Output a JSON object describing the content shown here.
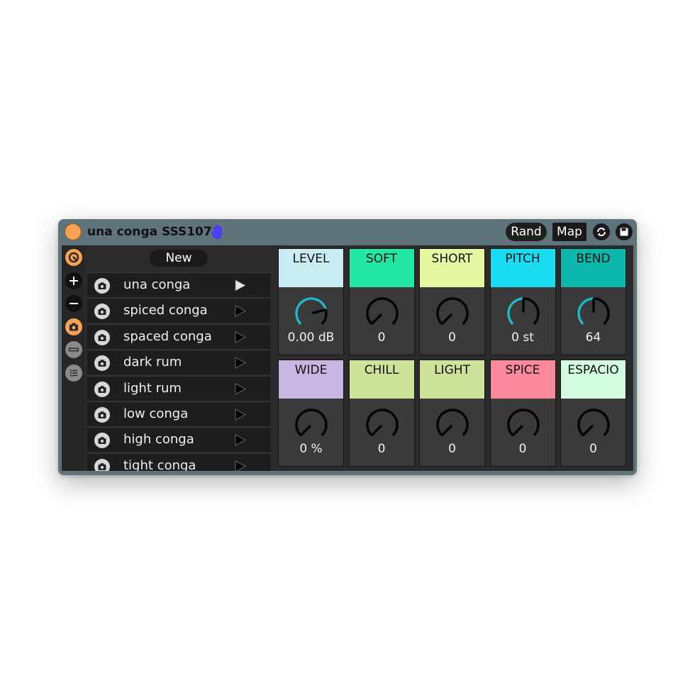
{
  "device": {
    "title": "una conga SSS107",
    "rand_label": "Rand",
    "map_label": "Map",
    "icons": [
      "power-icon",
      "hand-icon",
      "sync-icon",
      "save-icon"
    ]
  },
  "sidebar": {
    "icons": [
      "logo-icon",
      "plus-icon",
      "minus-icon",
      "camera-icon",
      "bar-icon",
      "list-icon"
    ]
  },
  "presets": {
    "new_label": "New",
    "items": [
      {
        "name": "una conga",
        "active": true
      },
      {
        "name": "spiced conga",
        "active": false
      },
      {
        "name": "spaced conga",
        "active": false
      },
      {
        "name": "dark rum",
        "active": false
      },
      {
        "name": "light rum",
        "active": false
      },
      {
        "name": "low conga",
        "active": false
      },
      {
        "name": "high conga",
        "active": false
      },
      {
        "name": "tight conga",
        "active": false
      }
    ]
  },
  "params": [
    {
      "label": "LEVEL",
      "value": "0.00 dB",
      "color": "#c9ecf3",
      "knob": "level"
    },
    {
      "label": "SOFT",
      "value": "0",
      "color": "#22e7a6",
      "knob": "zero"
    },
    {
      "label": "SHORT",
      "value": "0",
      "color": "#e6f7a2",
      "knob": "zero"
    },
    {
      "label": "PITCH",
      "value": "0 st",
      "color": "#19dcf0",
      "knob": "center"
    },
    {
      "label": "BEND",
      "value": "64",
      "color": "#0cb8ab",
      "knob": "center"
    },
    {
      "label": "WIDE",
      "value": "0 %",
      "color": "#c8b6e2",
      "knob": "zero"
    },
    {
      "label": "CHILL",
      "value": "0",
      "color": "#cfe29a",
      "knob": "zero"
    },
    {
      "label": "LIGHT",
      "value": "0",
      "color": "#cfe29a",
      "knob": "zero"
    },
    {
      "label": "SPICE",
      "value": "0",
      "color": "#f7899a",
      "knob": "zero"
    },
    {
      "label": "ESPACIO",
      "value": "0",
      "color": "#d2fbe0",
      "knob": "zero"
    }
  ],
  "colors": {
    "accent_orange": "#f6a254",
    "knob_arc": "#1fb8cc",
    "frame": "#5f737b"
  }
}
